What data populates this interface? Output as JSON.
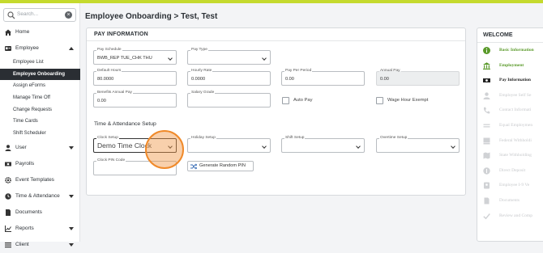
{
  "colors": {
    "accent": "#c5da2e",
    "active_nav_bg": "#2a2e33",
    "done_green": "#5a9a2a",
    "highlight": "#f08a2a"
  },
  "sidebar": {
    "search_placeholder": "Search...",
    "items": [
      {
        "label": "Home",
        "icon": "home-icon"
      },
      {
        "label": "Employee",
        "icon": "id-card-icon",
        "expanded": true
      }
    ],
    "sub_items": [
      {
        "label": "Employee List"
      },
      {
        "label": "Employee Onboarding",
        "active": true
      },
      {
        "label": "Assign eForms"
      },
      {
        "label": "Manage Time Off"
      },
      {
        "label": "Change Requests"
      },
      {
        "label": "Time Cards"
      },
      {
        "label": "Shift Scheduler"
      }
    ],
    "more_items": [
      {
        "label": "User",
        "icon": "user-icon",
        "caret": true
      },
      {
        "label": "Payrolls",
        "icon": "payroll-icon"
      },
      {
        "label": "Event Templates",
        "icon": "gear-icon"
      },
      {
        "label": "Time & Attendance",
        "icon": "clock-icon",
        "caret": true
      },
      {
        "label": "Documents",
        "icon": "document-icon"
      },
      {
        "label": "Reports",
        "icon": "chart-icon",
        "caret": true
      },
      {
        "label": "Client",
        "icon": "list-icon",
        "caret": true
      }
    ]
  },
  "page": {
    "title": "Employee Onboarding > Test, Test"
  },
  "pay_info": {
    "heading": "PAY INFORMATION",
    "pay_schedule": {
      "label": "Pay Schedule",
      "value": "BWB_REP TUE_CHK THU"
    },
    "pay_type": {
      "label": "Pay Type",
      "value": ""
    },
    "default_hours": {
      "label": "Default Hours",
      "value": "80.0000"
    },
    "hourly_rate": {
      "label": "Hourly Rate",
      "value": "0.0000"
    },
    "pay_per_period": {
      "label": "Pay Per Period",
      "value": "0.00"
    },
    "annual_pay": {
      "label": "Annual Pay",
      "value": "0.00"
    },
    "benefits_annual_pay": {
      "label": "Benefits Annual Pay",
      "value": "0.00"
    },
    "salary_grade": {
      "label": "Salary Grade",
      "value": ""
    },
    "auto_pay": {
      "label": "Auto Pay",
      "checked": false
    },
    "wage_hour_exempt": {
      "label": "Wage Hour Exempt",
      "checked": false
    },
    "ta_heading": "Time & Attendance Setup",
    "clock_setup": {
      "label": "Clock Setup",
      "value": "Demo Time Clock"
    },
    "holiday_setup": {
      "label": "Holiday Setup",
      "value": ""
    },
    "shift_setup": {
      "label": "Shift Setup",
      "value": ""
    },
    "overtime_setup": {
      "label": "Overtime Setup",
      "value": ""
    },
    "clock_pin": {
      "label": "Clock PIN Code",
      "value": ""
    },
    "generate_pin_label": "Generate Random PIN"
  },
  "welcome": {
    "heading": "WELCOME",
    "steps": [
      {
        "label": "Basic Information",
        "state": "done",
        "icon": "info-icon"
      },
      {
        "label": "Employment",
        "state": "done",
        "icon": "bank-icon"
      },
      {
        "label": "Pay Information",
        "state": "current",
        "icon": "money-icon"
      },
      {
        "label": "Employee Self Se",
        "state": "todo",
        "icon": "user-icon"
      },
      {
        "label": "Contact Informati",
        "state": "todo",
        "icon": "phone-icon"
      },
      {
        "label": "Equal Employmen",
        "state": "todo",
        "icon": "equals-icon"
      },
      {
        "label": "Federal Withholdi",
        "state": "todo",
        "icon": "flag-icon"
      },
      {
        "label": "State Withholding",
        "state": "todo",
        "icon": "map-icon"
      },
      {
        "label": "Direct Deposit",
        "state": "todo",
        "icon": "dollar-icon"
      },
      {
        "label": "Employee I-9 Ve",
        "state": "todo",
        "icon": "badge-icon"
      },
      {
        "label": "Documents",
        "state": "todo",
        "icon": "document-icon"
      },
      {
        "label": "Review and Comp",
        "state": "todo",
        "icon": "check-icon"
      }
    ]
  }
}
